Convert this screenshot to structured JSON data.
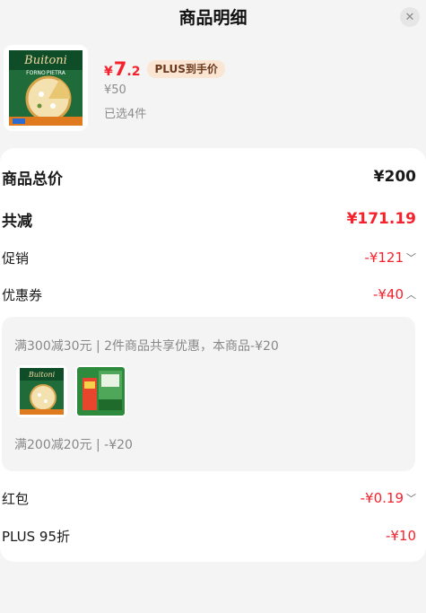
{
  "header": {
    "title": "商品明细",
    "close_icon": "close-icon"
  },
  "product": {
    "price_currency": "¥",
    "price_integer": "7",
    "price_decimal": ".2",
    "plus_tag": "PLUS到手价",
    "original_price": "¥50",
    "selected_count": "已选4件",
    "image_brand": "Buitoni",
    "image_subbrand": "FORNO PIETRA"
  },
  "summary": {
    "total_label": "商品总价",
    "total_value": "¥200",
    "reduce_label": "共减",
    "reduce_value": "¥171.19",
    "promo_label": "促销",
    "promo_value": "-¥121",
    "coupon_label": "优惠券",
    "coupon_value": "-¥40",
    "redpack_label": "红包",
    "redpack_value": "-¥0.19",
    "plus_label": "PLUS 95折",
    "plus_value": "-¥10"
  },
  "coupon_detail": {
    "line1": "满300减30元 | 2件商品共享优惠，本商品-¥20",
    "line2": "满200减20元 | -¥20"
  },
  "colors": {
    "accent_red": "#f5222d",
    "plus_tag_bg": "#fbe6d3",
    "page_bg": "#f4f4f4"
  }
}
